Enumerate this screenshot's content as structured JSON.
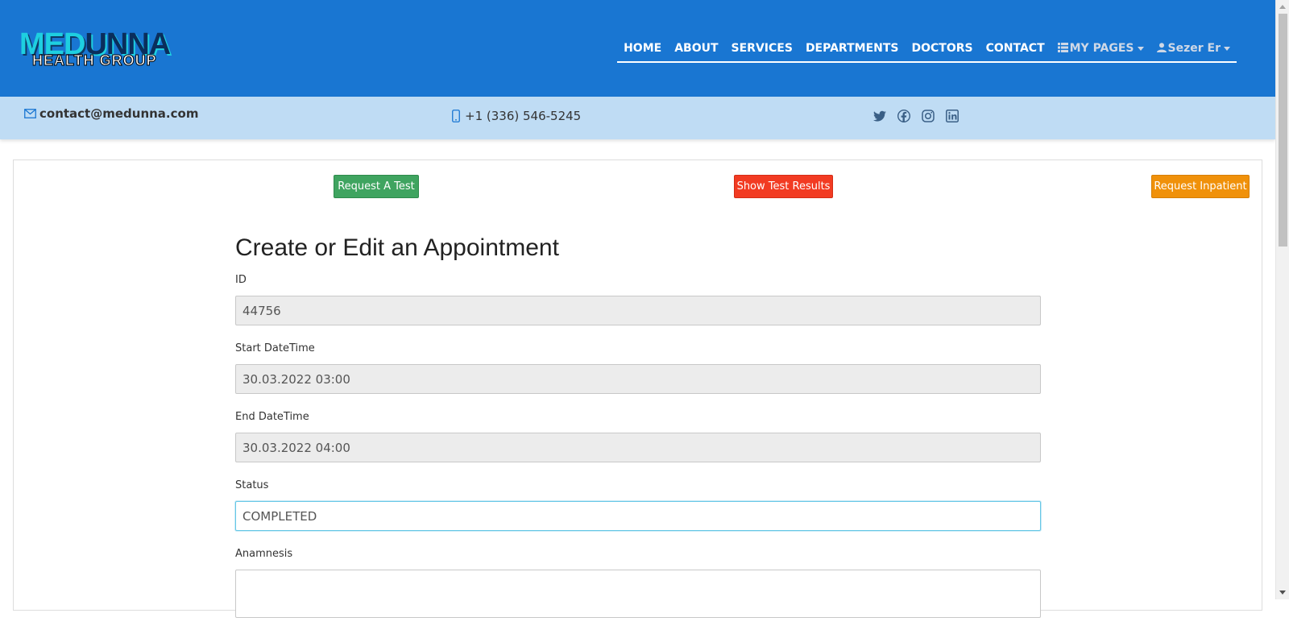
{
  "logo": {
    "top_part1": "MED",
    "top_part2": "UNNA",
    "bottom": "HEALTH GROUP"
  },
  "nav": {
    "items": [
      "HOME",
      "ABOUT",
      "SERVICES",
      "DEPARTMENTS",
      "DOCTORS",
      "CONTACT"
    ],
    "my_pages": "MY PAGES",
    "user": "Sezer Er"
  },
  "contact": {
    "email": "contact@medunna.com",
    "phone": "+1 (336) 546-5245",
    "socials": [
      "twitter-icon",
      "facebook-icon",
      "instagram-icon",
      "linkedin-icon"
    ]
  },
  "actions": {
    "request_test": "Request A Test",
    "show_results": "Show Test Results",
    "request_inpatient": "Request Inpatient"
  },
  "form": {
    "title": "Create or Edit an Appointment",
    "fields": [
      {
        "label": "ID",
        "value": "44756"
      },
      {
        "label": "Start DateTime",
        "value": "30.03.2022 03:00"
      },
      {
        "label": "End DateTime",
        "value": "30.03.2022 04:00"
      },
      {
        "label": "Status",
        "value": "COMPLETED"
      },
      {
        "label": "Anamnesis",
        "value": ""
      }
    ]
  },
  "colors": {
    "header": "#1976d2",
    "contact_bar": "#bfdcf4",
    "btn_test": "#3fa460",
    "btn_results": "#f23b22",
    "btn_inpatient": "#f0910a"
  }
}
